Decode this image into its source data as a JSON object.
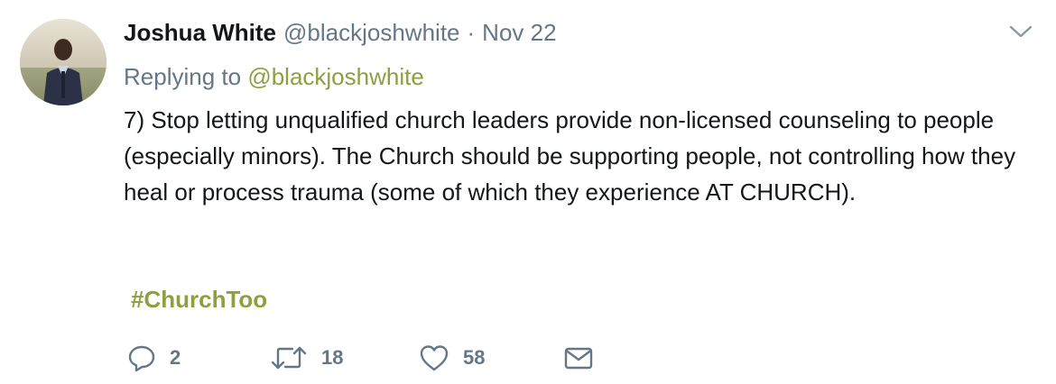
{
  "tweet": {
    "author_name": "Joshua White",
    "author_handle": "@blackjoshwhite",
    "separator": "·",
    "date": "Nov 22",
    "reply_prefix": "Replying to",
    "reply_to": "@blackjoshwhite",
    "text": "7) Stop letting unqualified church leaders provide non-licensed counseling to people (especially minors). The Church should be supporting people, not controlling how they heal or process trauma (some of which they experience AT CHURCH).",
    "hashtag": "#ChurchToo"
  },
  "actions": {
    "replies": "2",
    "retweets": "18",
    "likes": "58"
  },
  "icons": {
    "menu": "chevron-down-icon",
    "reply": "reply-icon",
    "retweet": "retweet-icon",
    "like": "heart-icon",
    "dm": "envelope-icon"
  },
  "colors": {
    "text": "#14171a",
    "secondary": "#657786",
    "accent": "#8f9e40"
  }
}
